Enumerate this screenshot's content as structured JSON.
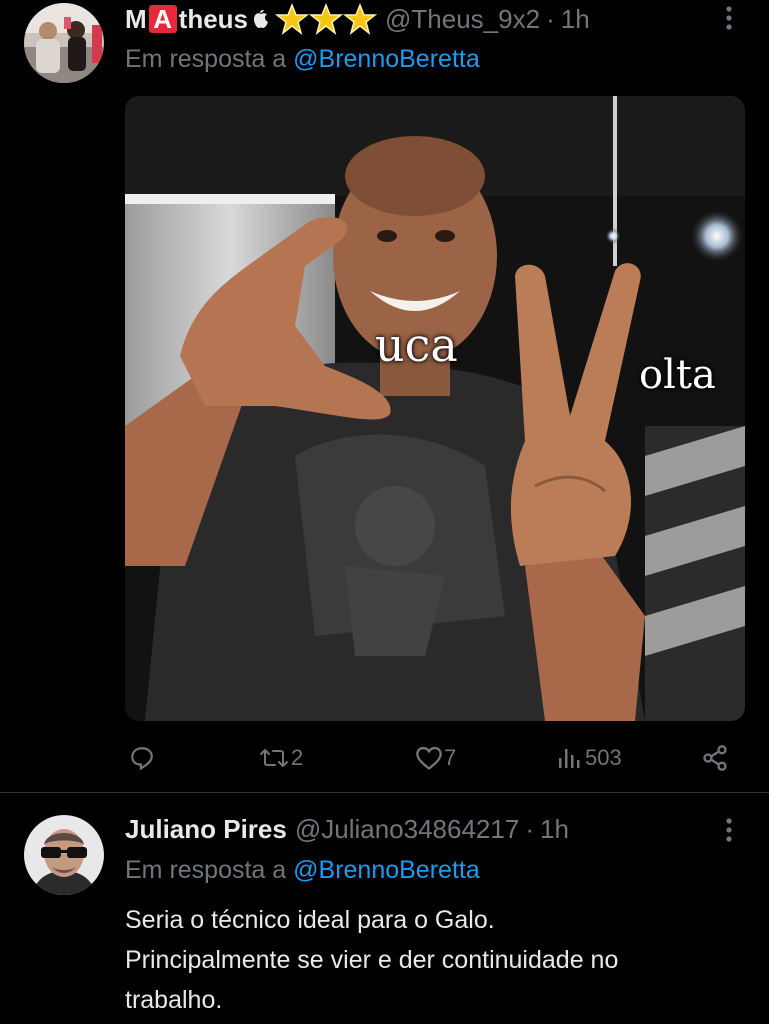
{
  "tweets": [
    {
      "name_part1": "M",
      "name_badge_letter": "A",
      "name_part2": "theus",
      "name_emojis": [
        "apple-icon",
        "glowing-star-icon",
        "glowing-star-icon",
        "glowing-star-icon"
      ],
      "handle": "@Theus_9x2",
      "separator": "·",
      "time": "1h",
      "reply_prefix": "Em resposta a",
      "reply_mention": "@BrennoBeretta",
      "image_overlay_left": "uca",
      "image_overlay_right": "olta",
      "actions": {
        "reply_count": "",
        "retweets": "2",
        "likes": "7",
        "views": "503"
      },
      "action_icons": [
        "reply-icon",
        "retweet-icon",
        "like-icon",
        "views-icon",
        "share-icon"
      ]
    },
    {
      "name": "Juliano Pires",
      "handle": "@Juliano34864217",
      "separator": "·",
      "time": "1h",
      "reply_prefix": "Em resposta a",
      "reply_mention": "@BrennoBeretta",
      "text_lines": [
        "Seria o técnico ideal para o Galo.",
        "Principalmente se vier e der continuidade no",
        "trabalho."
      ]
    }
  ],
  "colors": {
    "background": "#000000",
    "text": "#e7e9ea",
    "muted": "#71767b",
    "link": "#1d9bf0",
    "divider": "#2f3336",
    "badge": "#e8293b"
  }
}
